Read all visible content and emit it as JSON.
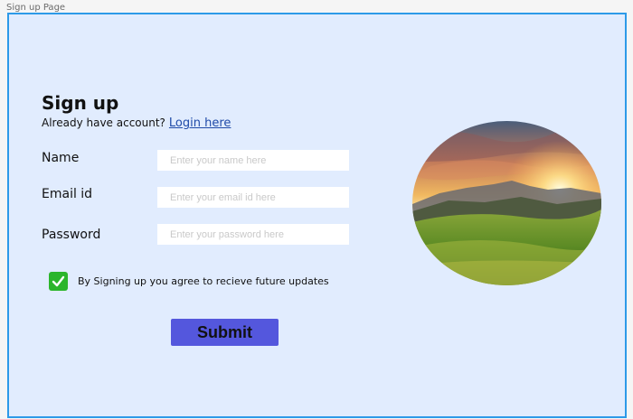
{
  "frame": {
    "label": "Sign up Page"
  },
  "form": {
    "title": "Sign up",
    "account_prompt": "Already have account?",
    "login_link": "Login here",
    "name_label": "Name",
    "name_placeholder": "Enter your name here",
    "email_label": "Email id",
    "email_placeholder": "Enter your email id here",
    "password_label": "Password",
    "password_placeholder": "Enter your password here",
    "agree_text": "By Signing up you agree to recieve future updates",
    "agree_checked": true,
    "submit_label": "Submit"
  },
  "image": {
    "subject": "sunset-mountain-meadow"
  },
  "colors": {
    "background": "#e1ecfe",
    "frame_border": "#2d9ae8",
    "submit_button": "#5457dd",
    "checkbox": "#2bb52b",
    "link": "#1f4aa8"
  }
}
